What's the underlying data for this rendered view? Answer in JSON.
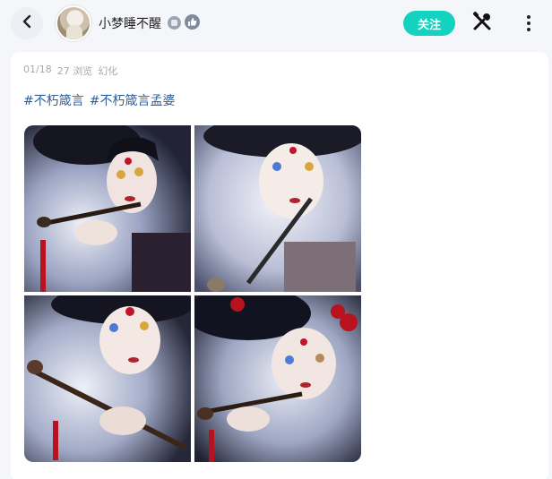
{
  "header": {
    "username": "小梦睡不醒",
    "follow_label": "关注",
    "icons": {
      "back": "chevron-left-icon",
      "tools": "tools-icon",
      "more": "more-vertical-icon",
      "badge_a": "verified-badge-icon",
      "badge_b": "like-badge-icon"
    }
  },
  "post": {
    "date": "01/18",
    "views": "27 浏览",
    "category": "幻化",
    "tags": [
      "#不朽箴言",
      "#不朽箴言孟婆"
    ],
    "images": [
      {
        "alt": "illustration of a woman in traditional attire smoking a long pipe"
      },
      {
        "alt": "illustration of a woman with heterochromia eyes holding a pipe"
      },
      {
        "alt": "illustration of a woman with golden eyes holding a red-tasseled pipe"
      },
      {
        "alt": "illustration of a woman with red flowers in hair holding a pipe"
      }
    ]
  },
  "colors": {
    "follow_bg": "#14d2c0",
    "tag": "#2f5f9a",
    "meta": "#a4a9b3",
    "background": "#f4f6fa"
  }
}
